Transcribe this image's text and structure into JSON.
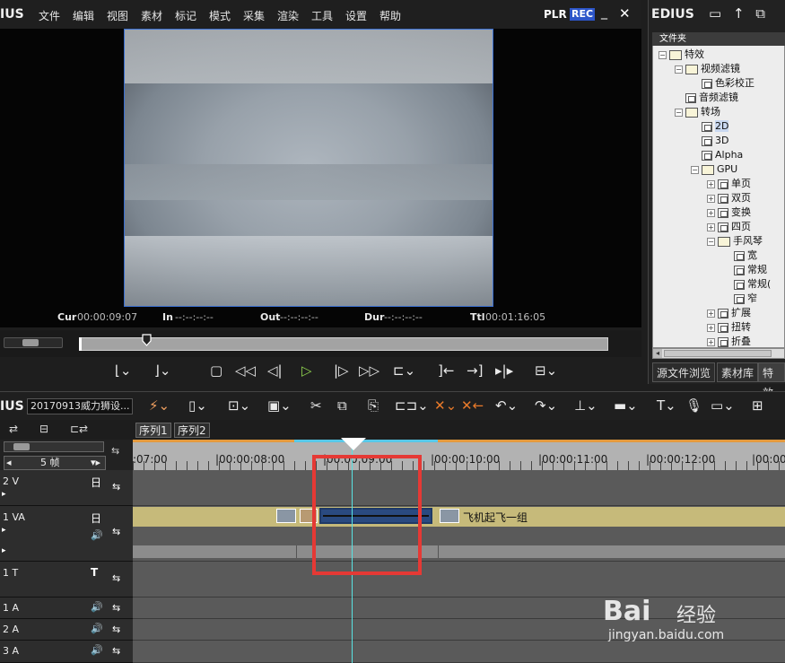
{
  "app": {
    "title": "IUS",
    "plr": "PLR",
    "rec": "REC",
    "min": "_",
    "close": "✕"
  },
  "menu": [
    "文件",
    "编辑",
    "视图",
    "素材",
    "标记",
    "模式",
    "采集",
    "渲染",
    "工具",
    "设置",
    "帮助"
  ],
  "timecodes": {
    "cur_label": "Cur",
    "cur": "00:00:09:07",
    "in_label": "In",
    "in": "--:--:--:--",
    "out_label": "Out",
    "out": "--:--:--:--",
    "dur_label": "Dur",
    "dur": "--:--:--:--",
    "ttl_label": "Ttl",
    "ttl": "00:01:16:05"
  },
  "right_panel": {
    "header": "EDIUS",
    "folder_title": "文件夹",
    "tree": [
      {
        "label": "特效",
        "depth": 0,
        "toggle": "−",
        "type": "folder"
      },
      {
        "label": "视频滤镜",
        "depth": 1,
        "toggle": "−",
        "type": "folder"
      },
      {
        "label": "色彩校正",
        "depth": 2,
        "toggle": "",
        "type": "effect"
      },
      {
        "label": "音频滤镜",
        "depth": 1,
        "toggle": "",
        "type": "effect"
      },
      {
        "label": "转场",
        "depth": 1,
        "toggle": "−",
        "type": "folder"
      },
      {
        "label": "2D",
        "depth": 2,
        "toggle": "",
        "type": "effect",
        "selected": true
      },
      {
        "label": "3D",
        "depth": 2,
        "toggle": "",
        "type": "effect"
      },
      {
        "label": "Alpha",
        "depth": 2,
        "toggle": "",
        "type": "effect"
      },
      {
        "label": "GPU",
        "depth": 2,
        "toggle": "−",
        "type": "folder"
      },
      {
        "label": "单页",
        "depth": 3,
        "toggle": "+",
        "type": "effect"
      },
      {
        "label": "双页",
        "depth": 3,
        "toggle": "+",
        "type": "effect"
      },
      {
        "label": "变换",
        "depth": 3,
        "toggle": "+",
        "type": "effect"
      },
      {
        "label": "四页",
        "depth": 3,
        "toggle": "+",
        "type": "effect"
      },
      {
        "label": "手风琴",
        "depth": 3,
        "toggle": "−",
        "type": "folder"
      },
      {
        "label": "宽",
        "depth": 4,
        "toggle": "",
        "type": "effect"
      },
      {
        "label": "常规",
        "depth": 4,
        "toggle": "",
        "type": "effect"
      },
      {
        "label": "常规(",
        "depth": 4,
        "toggle": "",
        "type": "effect"
      },
      {
        "label": "窄",
        "depth": 4,
        "toggle": "",
        "type": "effect"
      },
      {
        "label": "扩展",
        "depth": 3,
        "toggle": "+",
        "type": "effect"
      },
      {
        "label": "扭转",
        "depth": 3,
        "toggle": "+",
        "type": "effect"
      },
      {
        "label": "折叠",
        "depth": 3,
        "toggle": "+",
        "type": "effect"
      }
    ],
    "tabs": [
      "源文件浏览",
      "素材库",
      "特效"
    ]
  },
  "timeline": {
    "app_label": "IUS",
    "project_name": "20170913威力狮设...",
    "sequences": [
      "序列1",
      "序列2"
    ],
    "frame_unit": "5 帧",
    "ruler": [
      ":07:00",
      "|00:00:08:00",
      "|00:00:09:00",
      "|00:00:10:00",
      "|00:00:11:00",
      "|00:00:12:00",
      "|00:00"
    ],
    "tracks": [
      {
        "name": "2 V"
      },
      {
        "name": "1 VA"
      },
      {
        "name": "1 T"
      },
      {
        "name": "1 A"
      },
      {
        "name": "2 A"
      },
      {
        "name": "3 A"
      }
    ],
    "clip_label": "飞机起飞一组"
  },
  "watermark": {
    "logo": "Bai",
    "text": "经验",
    "url": "jingyan.baidu.com"
  },
  "colors": {
    "accent_blue": "#2d56c9",
    "playhead": "#58e2e2",
    "highlight": "#e53935",
    "clip": "#c6ba7a"
  }
}
